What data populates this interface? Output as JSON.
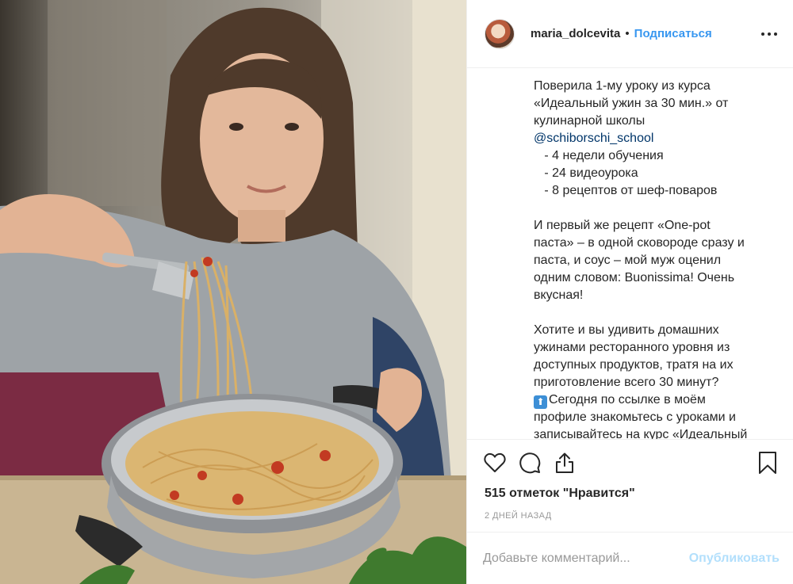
{
  "post": {
    "username": "maria_dolcevita",
    "separator": "•",
    "follow_label": "Подписаться",
    "caption_lines": [
      "Поверила 1-му уроку из курса",
      "«Идеальный ужин за 30 мин.» от",
      "кулинарной школы",
      "@schiborschi_school",
      "   - 4 недели обучения",
      "   - 24 видеоурока",
      "   - 8 рецептов от шеф-поваров",
      "",
      "И первый же рецепт «One-pot",
      "паста» – в одной сковороде сразу и",
      "паста, и соус – мой муж оценил",
      "одним словом: Buonissima! Очень",
      "вкусная!",
      "",
      "Хотите и вы удивить домашних",
      "ужинами ресторанного уровня из",
      "доступных продуктов, тратя на их",
      "приготовление всего 30 минут?",
      "Сегодня по ссылке в моём",
      "профиле знакомьтесь с уроками и",
      "записывайтесь на курс «Идеальный"
    ],
    "emoji_glyph": "⬆",
    "likes_text": "515 отметок \"Нравится\"",
    "date_text": "2 дней назад"
  },
  "comment": {
    "placeholder": "Добавьте комментарий...",
    "publish_label": "Опубликовать"
  },
  "icons": {
    "like": "heart-icon",
    "comment": "comment-icon",
    "share": "share-icon",
    "save": "bookmark-icon",
    "more": "more-options-icon"
  },
  "colors": {
    "link": "#3897f0",
    "mention": "#003569",
    "publish_disabled": "#b2dffc",
    "muted": "#999999",
    "text": "#262626"
  }
}
